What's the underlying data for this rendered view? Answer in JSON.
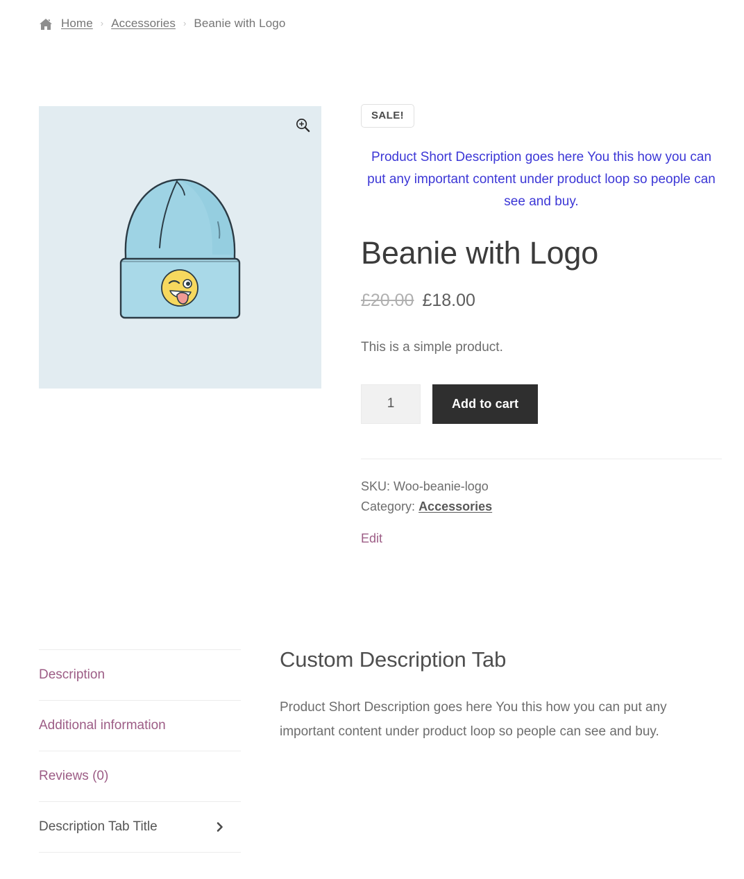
{
  "breadcrumb": {
    "home_icon": "home-icon",
    "items": [
      {
        "label": "Home",
        "type": "link"
      },
      {
        "label": "Accessories",
        "type": "link"
      },
      {
        "label": "Beanie with Logo",
        "type": "current"
      }
    ],
    "separator": "›"
  },
  "gallery": {
    "zoom_icon": "magnify-plus-icon",
    "image_alt": "Light blue beanie with winking tongue-out emoji logo",
    "background_color": "#e2ecf1"
  },
  "product": {
    "sale_badge": "SALE!",
    "short_description": "Product Short Description goes here You this how you can put any important content under product loop so people can see and buy.",
    "short_description_color": "#3c37d6",
    "title": "Beanie with Logo",
    "price_old": "£20.00",
    "price_new": "£18.00",
    "stock_status": "This is a simple product.",
    "quantity_value": "1",
    "quantity_placeholder": "1",
    "add_to_cart_label": "Add to cart",
    "add_to_cart_color": "#2f2f2f",
    "meta": {
      "sku_label": "SKU:",
      "sku_value": "Woo-beanie-logo",
      "category_label": "Category:",
      "category_value": "Accessories"
    },
    "edit_label": "Edit",
    "edit_color": "#9c5c85"
  },
  "tabs": {
    "items": [
      {
        "label": "Description",
        "active": false,
        "has_chevron": false
      },
      {
        "label": "Additional information",
        "active": false,
        "has_chevron": false
      },
      {
        "label": "Reviews (0)",
        "active": false,
        "has_chevron": false
      },
      {
        "label": "Description Tab Title",
        "active": true,
        "has_chevron": true
      }
    ],
    "chevron_icon": "chevron-right-icon",
    "active_color": "#555555",
    "inactive_color": "#9c5c85"
  },
  "tab_panel": {
    "title": "Custom Description Tab",
    "body": "Product Short Description goes here You this how you can put any important content under product loop so people can see and buy."
  }
}
